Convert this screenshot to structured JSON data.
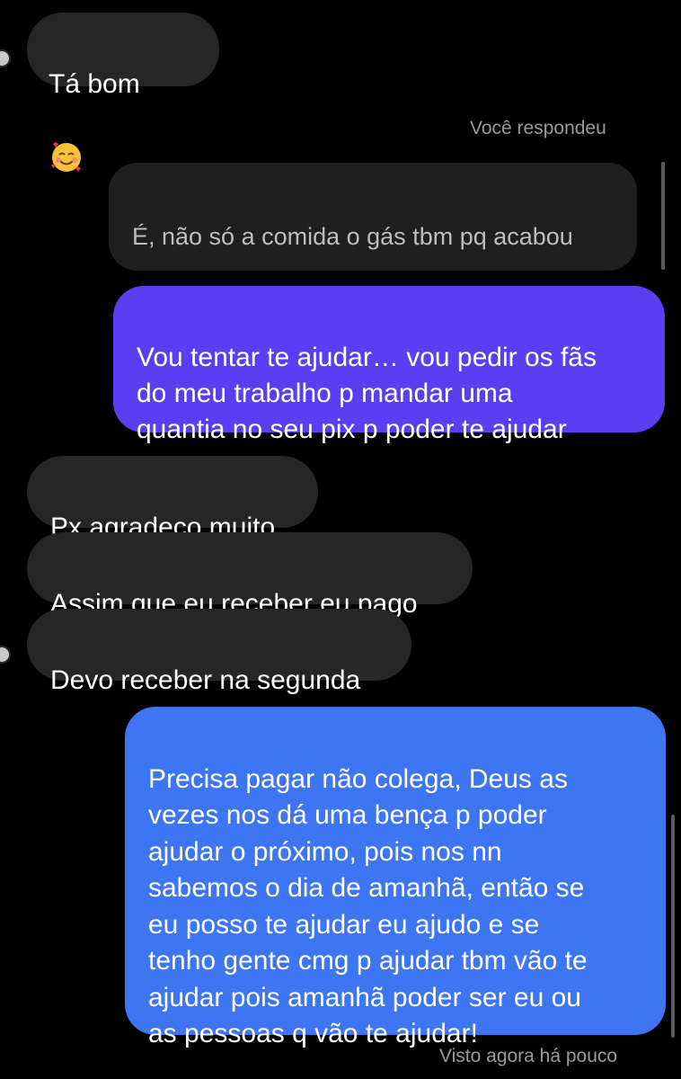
{
  "messages": {
    "m1": "Tá bom",
    "replied_label": "Você respondeu",
    "quoted": "É, não só a comida o gás tbm pq acabou",
    "out1": "Vou tentar te ajudar… vou pedir os fãs\ndo meu trabalho p mandar uma\nquantia no seu pix p poder te ajudar",
    "in1": "Px agradeço muito",
    "in2": "Assim que eu receber eu pago",
    "in3": "Devo receber na segunda",
    "out2": "Precisa pagar não colega, Deus as\nvezes nos dá uma bença p poder\najudar o próximo, pois nos nn\nsabemos o dia de amanhã, então se\neu posso te ajudar eu ajudo e se\ntenho gente cmg p ajudar tbm vão te\najudar pois amanhã poder ser eu ou\nas pessoas q vão te ajudar!",
    "seen": "Visto agora há pouco"
  },
  "icons": {
    "smiling_hearts": "smiling-face-with-hearts-icon",
    "facepalm": "woman-facepalming-icon"
  },
  "colors": {
    "incoming": "#262626",
    "quoted": "#1f1f1f",
    "outgoing_purple": "#5c3ef2",
    "outgoing_blue": "#3d75f2"
  }
}
